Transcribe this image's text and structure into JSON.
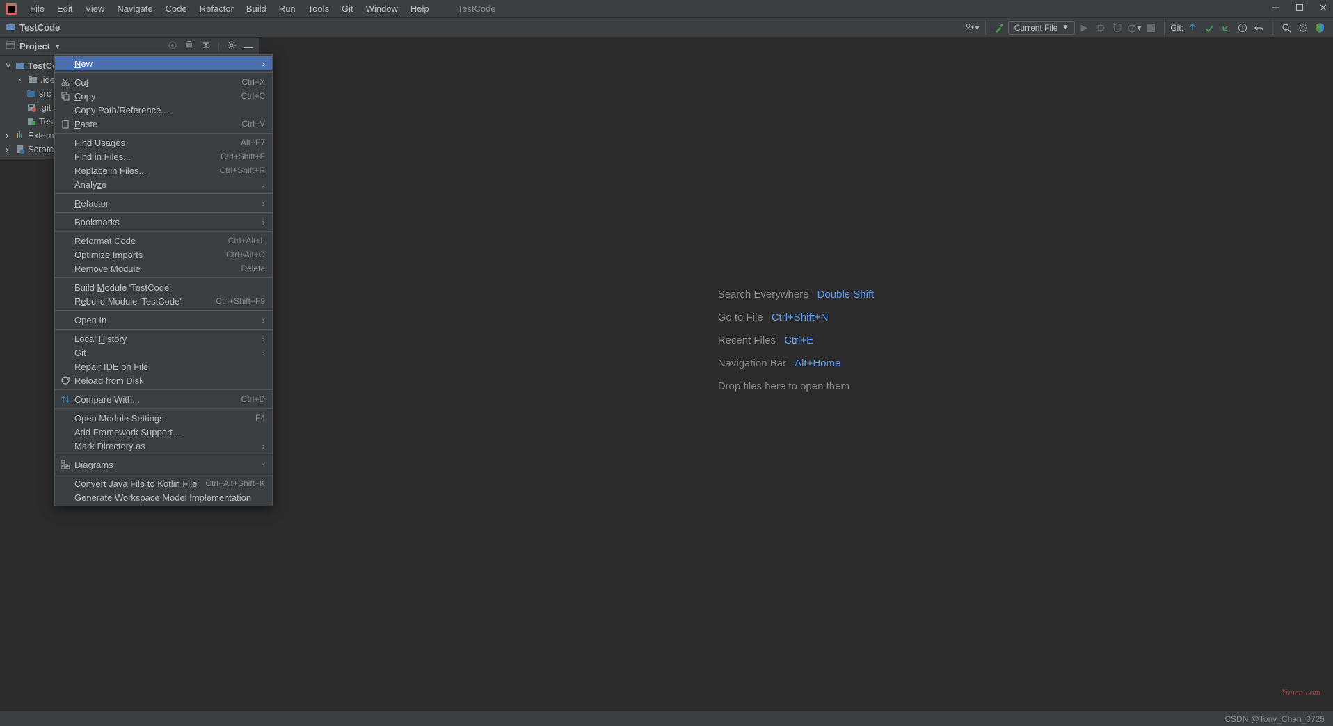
{
  "window": {
    "title": "TestCode",
    "menu": [
      "File",
      "Edit",
      "View",
      "Navigate",
      "Code",
      "Refactor",
      "Build",
      "Run",
      "Tools",
      "Git",
      "Window",
      "Help"
    ],
    "menu_underline_idx": {
      "File": 0,
      "Edit": 0,
      "View": 0,
      "Navigate": 0,
      "Code": 0,
      "Refactor": 0,
      "Build": 0,
      "Run": 1,
      "Tools": 0,
      "Git": 0,
      "Window": 0,
      "Help": 0
    }
  },
  "breadcrumb": {
    "project": "TestCode"
  },
  "toolbar": {
    "run_config": "Current File",
    "git_label": "Git:"
  },
  "project_tool": {
    "title": "Project"
  },
  "tree": {
    "project": "TestCo",
    "items": [
      ".ide",
      "src",
      ".git",
      "Tes"
    ],
    "external": "Externa",
    "scratches": "Scratch"
  },
  "context_menu": {
    "groups": [
      [
        {
          "label": "New",
          "arrow": true,
          "selected": true,
          "underline": 0
        }
      ],
      [
        {
          "icon": "cut",
          "label": "Cut",
          "sc": "Ctrl+X",
          "underline": 2
        },
        {
          "icon": "copy",
          "label": "Copy",
          "sc": "Ctrl+C",
          "underline": 0
        },
        {
          "label": "Copy Path/Reference..."
        },
        {
          "icon": "paste",
          "label": "Paste",
          "sc": "Ctrl+V",
          "underline": 0
        }
      ],
      [
        {
          "label": "Find Usages",
          "sc": "Alt+F7",
          "underline": 5
        },
        {
          "label": "Find in Files...",
          "sc": "Ctrl+Shift+F"
        },
        {
          "label": "Replace in Files...",
          "sc": "Ctrl+Shift+R"
        },
        {
          "label": "Analyze",
          "arrow": true,
          "underline": 5
        }
      ],
      [
        {
          "label": "Refactor",
          "arrow": true,
          "underline": 0
        }
      ],
      [
        {
          "label": "Bookmarks",
          "arrow": true
        }
      ],
      [
        {
          "label": "Reformat Code",
          "sc": "Ctrl+Alt+L",
          "underline": 0
        },
        {
          "label": "Optimize Imports",
          "sc": "Ctrl+Alt+O",
          "underline": 9
        },
        {
          "label": "Remove Module",
          "sc": "Delete"
        }
      ],
      [
        {
          "label": "Build Module 'TestCode'",
          "underline": 6
        },
        {
          "label": "Rebuild Module 'TestCode'",
          "sc": "Ctrl+Shift+F9",
          "underline": 1
        }
      ],
      [
        {
          "label": "Open In",
          "arrow": true
        }
      ],
      [
        {
          "label": "Local History",
          "arrow": true,
          "underline": 6
        },
        {
          "label": "Git",
          "arrow": true,
          "underline": 0
        },
        {
          "label": "Repair IDE on File"
        },
        {
          "icon": "reload",
          "label": "Reload from Disk"
        }
      ],
      [
        {
          "icon": "compare",
          "label": "Compare With...",
          "sc": "Ctrl+D"
        }
      ],
      [
        {
          "label": "Open Module Settings",
          "sc": "F4"
        },
        {
          "label": "Add Framework Support..."
        },
        {
          "label": "Mark Directory as",
          "arrow": true
        }
      ],
      [
        {
          "icon": "diagram",
          "label": "Diagrams",
          "arrow": true,
          "underline": 0
        }
      ],
      [
        {
          "label": "Convert Java File to Kotlin File",
          "sc": "Ctrl+Alt+Shift+K"
        },
        {
          "label": "Generate Workspace Model Implementation"
        }
      ]
    ]
  },
  "placeholder": {
    "rows": [
      {
        "label": "Search Everywhere",
        "shortcut": "Double Shift"
      },
      {
        "label": "Go to File",
        "shortcut": "Ctrl+Shift+N"
      },
      {
        "label": "Recent Files",
        "shortcut": "Ctrl+E"
      },
      {
        "label": "Navigation Bar",
        "shortcut": "Alt+Home"
      },
      {
        "label": "Drop files here to open them",
        "shortcut": ""
      }
    ]
  },
  "statusbar": {
    "text": "CSDN @Tony_Chen_0725"
  },
  "watermark": "Yuucn.com"
}
